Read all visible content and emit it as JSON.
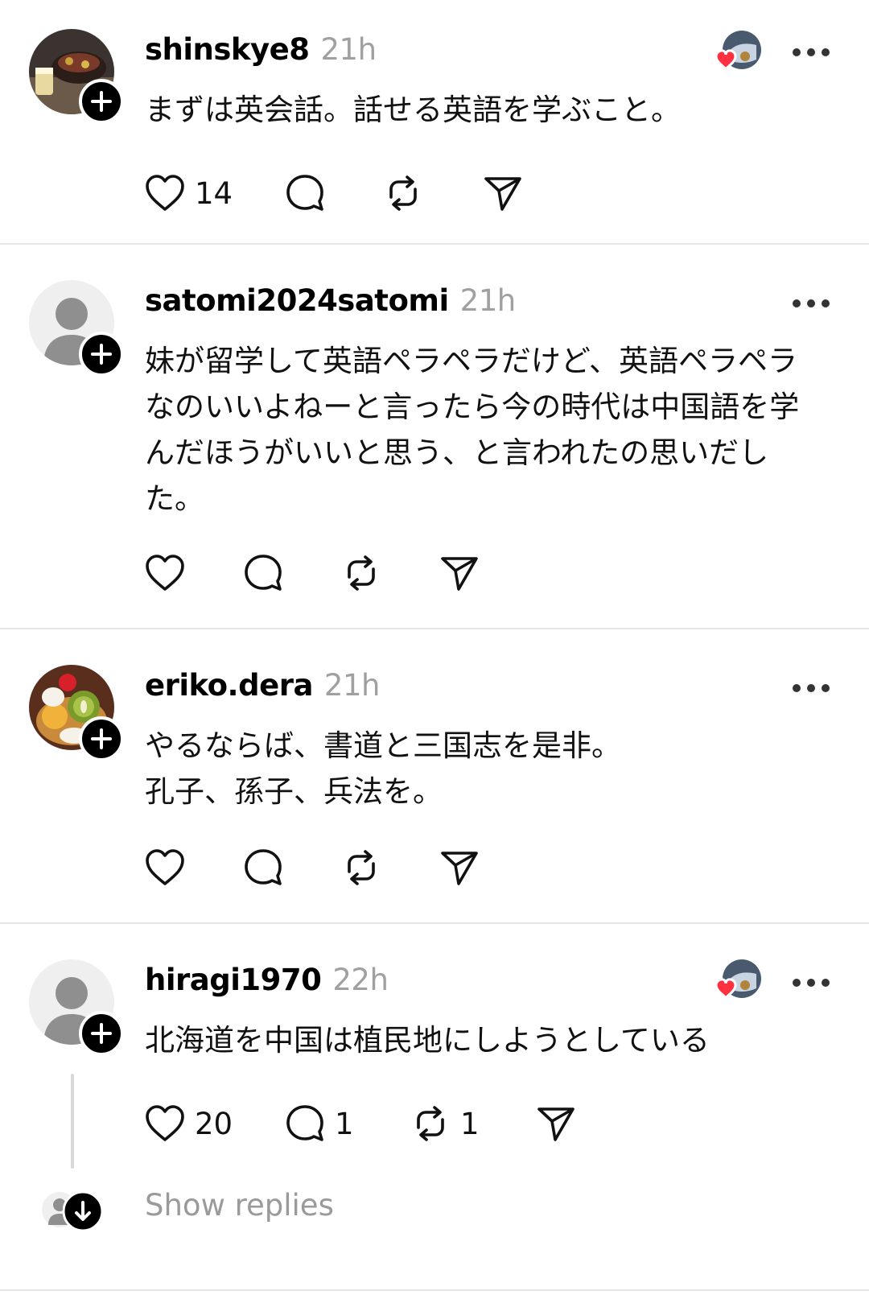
{
  "posts": [
    {
      "username": "shinskye8",
      "time": "21h",
      "lines": [
        "まずは英会話。話せる英語を学ぶこと。"
      ],
      "likes": "14",
      "replies": "",
      "reposts": "",
      "avatar_icon": "food-photo-avatar",
      "liked_by_author": true
    },
    {
      "username": "satomi2024satomi",
      "time": "21h",
      "lines": [
        "妹が留学して英語ペラペラだけど、英語ペラペラ",
        "なのいいよねーと言ったら今の時代は中国語を学",
        "んだほうがいいと思う、と言われたの思いだし",
        "た。"
      ],
      "likes": "",
      "replies": "",
      "reposts": "",
      "avatar_icon": "default-person-avatar",
      "liked_by_author": false
    },
    {
      "username": "eriko.dera",
      "time": "21h",
      "lines": [
        "やるならば、書道と三国志を是非。",
        "孔子、孫子、兵法を。"
      ],
      "likes": "",
      "replies": "",
      "reposts": "",
      "avatar_icon": "dessert-photo-avatar",
      "liked_by_author": false
    },
    {
      "username": "hiragi1970",
      "time": "22h",
      "lines": [
        "北海道を中国は植民地にしようとしている"
      ],
      "likes": "20",
      "replies": "1",
      "reposts": "1",
      "avatar_icon": "default-person-avatar",
      "liked_by_author": true
    }
  ],
  "show_replies": "Show replies",
  "colors": {
    "heart_red": "#ff3040",
    "muted_gray": "#a0a0a0",
    "divider": "#e6e6e6"
  }
}
